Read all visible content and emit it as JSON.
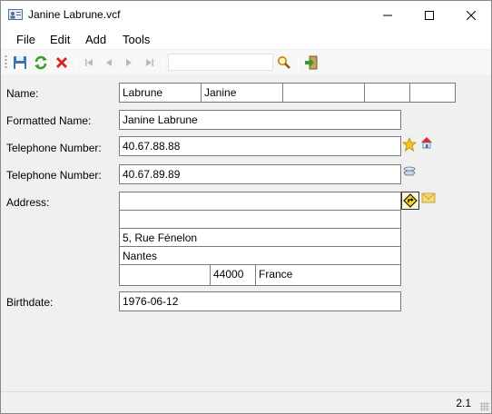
{
  "window": {
    "title": "Janine Labrune.vcf"
  },
  "menu": {
    "file": "File",
    "edit": "Edit",
    "add": "Add",
    "tools": "Tools"
  },
  "toolbar": {
    "search_value": "",
    "icons": [
      "save-icon",
      "refresh-icon",
      "delete-icon",
      "first-record-icon",
      "previous-record-icon",
      "next-record-icon",
      "last-record-icon",
      "search-icon",
      "exit-icon"
    ]
  },
  "form": {
    "name_label": "Name:",
    "name_parts": [
      "Labrune",
      "Janine",
      "",
      "",
      ""
    ],
    "formatted_name_label": "Formatted Name:",
    "formatted_name": "Janine Labrune",
    "phone1_label": "Telephone Number:",
    "phone1": "40.67.88.88",
    "phone2_label": "Telephone Number:",
    "phone2": "40.67.89.89",
    "address_label": "Address:",
    "address": {
      "line1": "",
      "line2": "",
      "street": "5, Rue Fénelon",
      "city": "Nantes",
      "region": "",
      "postal_code": "44000",
      "country": "France"
    },
    "birthdate_label": "Birthdate:",
    "birthdate": "1976-06-12"
  },
  "status": {
    "version": "2.1"
  },
  "colors": {
    "title_bg": "#ffffff",
    "window_bg": "#f0f0f0",
    "field_border": "#7a7a7a",
    "delete_red": "#d9262c",
    "refresh_green": "#3a9a2a"
  }
}
